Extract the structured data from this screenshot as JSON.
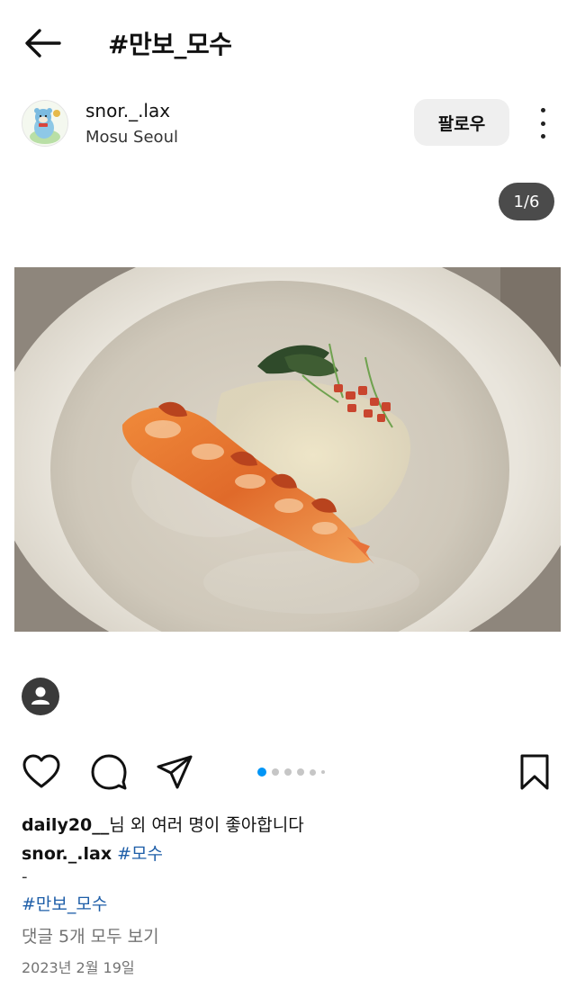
{
  "header": {
    "title": "#만보_모수",
    "back_icon": "arrow-left-icon"
  },
  "post": {
    "username": "snor._.lax",
    "location": "Mosu Seoul",
    "follow_label": "팔로우",
    "more_icon": "more-vertical-icon",
    "counter": "1/6",
    "image_description_icon": "plated-lobster-photo",
    "dots_total": 6,
    "dots_active_index": 0
  },
  "actions": {
    "like_icon": "heart-icon",
    "comment_icon": "comment-icon",
    "share_icon": "send-icon",
    "save_icon": "bookmark-icon",
    "tag_icon": "user-tag-icon"
  },
  "likes": {
    "user": "daily20__",
    "suffix": "님 외 여러 명이 좋아합니다"
  },
  "caption": {
    "username": "snor._.lax",
    "hashtag": "#모수",
    "dash": "-",
    "tagline": "#만보_모수"
  },
  "comments": {
    "label": "댓글 5개 모두 보기"
  },
  "date": "2023년 2월 19일",
  "colors": {
    "link": "#1e5ea8",
    "active_dot": "#0095f6",
    "muted": "#737373"
  }
}
